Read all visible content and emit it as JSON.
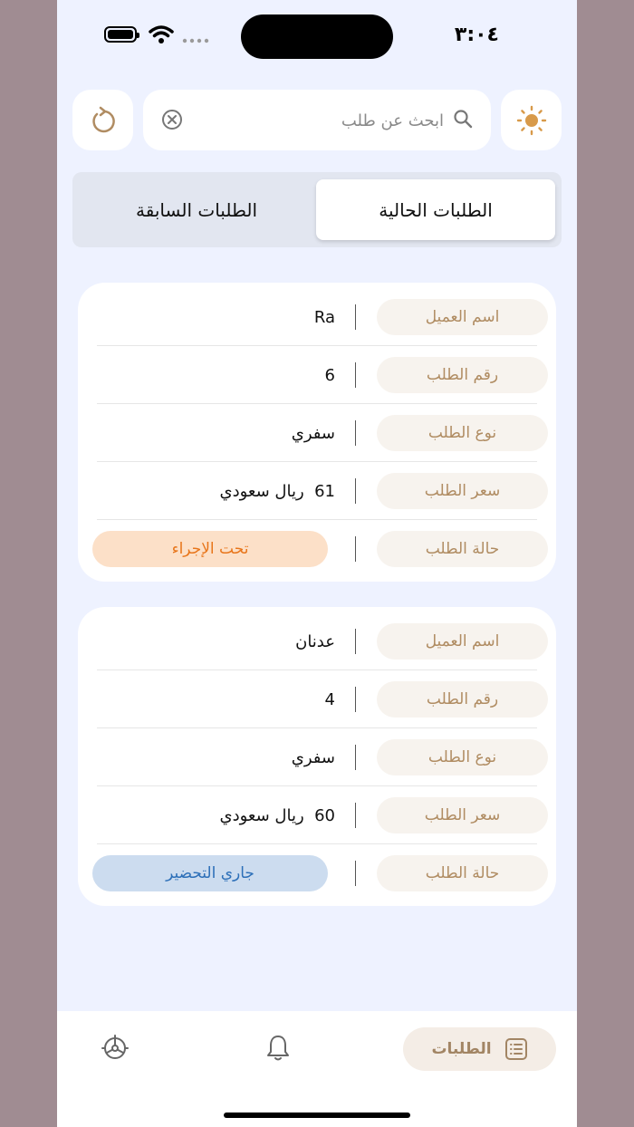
{
  "status_bar": {
    "time": "٣:٠٤"
  },
  "search": {
    "placeholder": "ابحث عن طلب",
    "value": ""
  },
  "icons": {
    "theme": "sun-icon",
    "refresh": "refresh-icon",
    "search": "search-icon",
    "clear": "clear-icon",
    "orders": "list-icon",
    "notifications": "bell-icon",
    "settings": "gear-icon"
  },
  "tabs": {
    "current": "الطلبات الحالية",
    "previous": "الطلبات السابقة"
  },
  "labels": {
    "customer_name": "اسم العميل",
    "order_number": "رقم الطلب",
    "order_type": "نوع الطلب",
    "order_price": "سعر الطلب",
    "order_status": "حالة الطلب"
  },
  "orders": [
    {
      "customer_name": "Ra",
      "order_number": "6",
      "order_type": "سفري",
      "price_amount": "61",
      "price_currency": "ريال سعودي",
      "status": "تحت الإجراء",
      "status_color": "#e8751a"
    },
    {
      "customer_name": "عدنان",
      "order_number": "4",
      "order_type": "سفري",
      "price_amount": "60",
      "price_currency": "ريال سعودي",
      "status": "جاري التحضير",
      "status_color": "#2c6fb8"
    }
  ],
  "bottom_nav": {
    "orders_label": "الطلبات"
  },
  "colors": {
    "accent": "#b08c62",
    "background": "#eef2ff"
  }
}
